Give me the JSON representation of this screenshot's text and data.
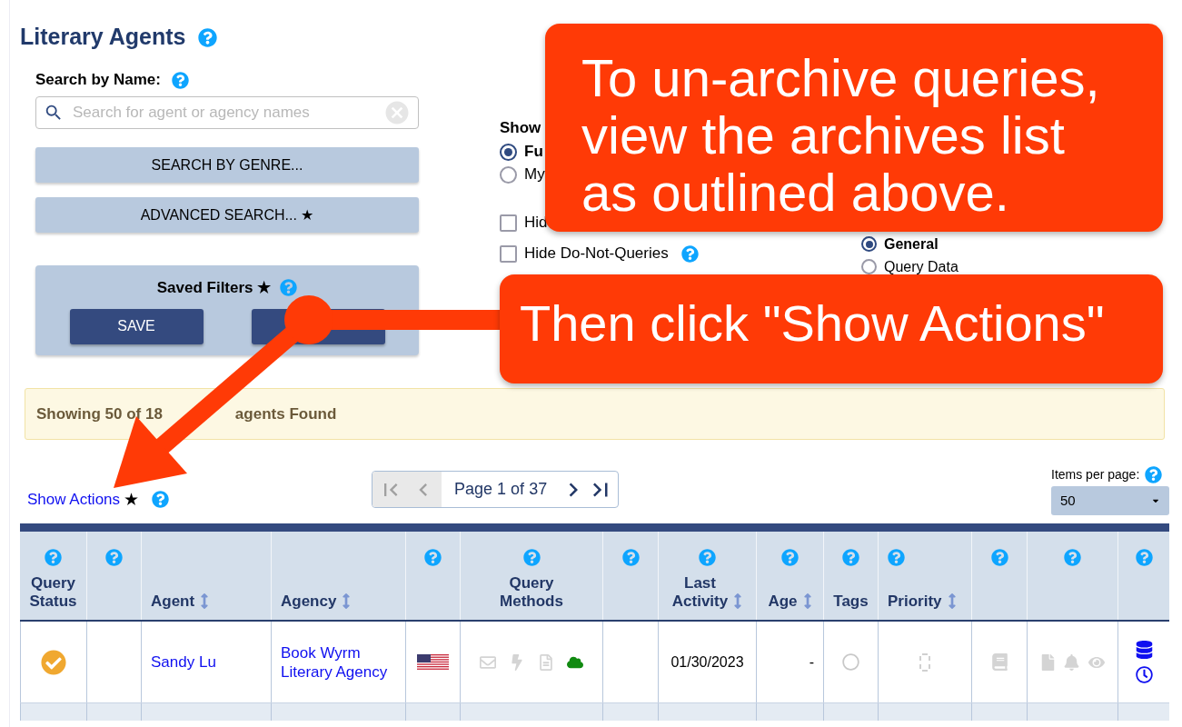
{
  "title": "Literary Agents",
  "search": {
    "label": "Search by Name:",
    "placeholder": "Search for agent or agency names"
  },
  "search_buttons": [
    "SEARCH BY GENRE...",
    "ADVANCED SEARCH... ★"
  ],
  "saved_filters": {
    "title": "Saved Filters ★",
    "save_label": "SAVE"
  },
  "show_group": {
    "label": "Show",
    "options": [
      {
        "label": "Fu",
        "selected": true
      },
      {
        "label": "My",
        "selected": false
      }
    ]
  },
  "checkboxes": [
    {
      "label": "Hid",
      "checked": false,
      "help": false
    },
    {
      "label": "Hide Do-Not-Queries",
      "checked": false,
      "help": true
    }
  ],
  "view_options": [
    {
      "label": "General",
      "selected": true
    },
    {
      "label": "Query Data",
      "selected": false
    }
  ],
  "results": {
    "before": "Showing 50 of 18",
    "after": "agents Found"
  },
  "show_actions": {
    "label": "Show Actions",
    "star": "★"
  },
  "pager": {
    "label": "Page 1 of 37"
  },
  "items_per_page": {
    "label": "Items per page:",
    "value": "50"
  },
  "table": {
    "columns": [
      {
        "label": "Query\nStatus",
        "help": true,
        "sortable": false
      },
      {
        "help": true,
        "sortable": false
      },
      {
        "label": "Agent",
        "help": false,
        "sortable": true
      },
      {
        "label": "Agency",
        "help": false,
        "sortable": true
      },
      {
        "help": true,
        "sortable": false
      },
      {
        "label": "Query\nMethods",
        "help": true,
        "sortable": false
      },
      {
        "help": true,
        "sortable": false
      },
      {
        "label": "Last\nActivity",
        "help": true,
        "sortable": true
      },
      {
        "label": "Age",
        "help": true,
        "sortable": true
      },
      {
        "label": "Tags",
        "help": true,
        "sortable": false
      },
      {
        "label": "Priority",
        "help": true,
        "sortable": true
      },
      {
        "help": true,
        "sortable": false
      },
      {
        "help": true,
        "sortable": false
      },
      {
        "help": true,
        "sortable": false
      }
    ],
    "rows": [
      {
        "agent": "Sandy Lu",
        "agency": "Book Wyrm\nLiterary Agency",
        "methods": [
          {
            "kind": "email",
            "active": false
          },
          {
            "kind": "quick",
            "active": false
          },
          {
            "kind": "form",
            "active": false
          },
          {
            "kind": "online",
            "active": true
          }
        ],
        "last_activity": "01/30/2023",
        "age": "-"
      }
    ]
  },
  "callouts": [
    {
      "text": "To un-archive queries,\nview the archives list\nas outlined above."
    },
    {
      "text": "Then click \"Show Actions\""
    }
  ]
}
